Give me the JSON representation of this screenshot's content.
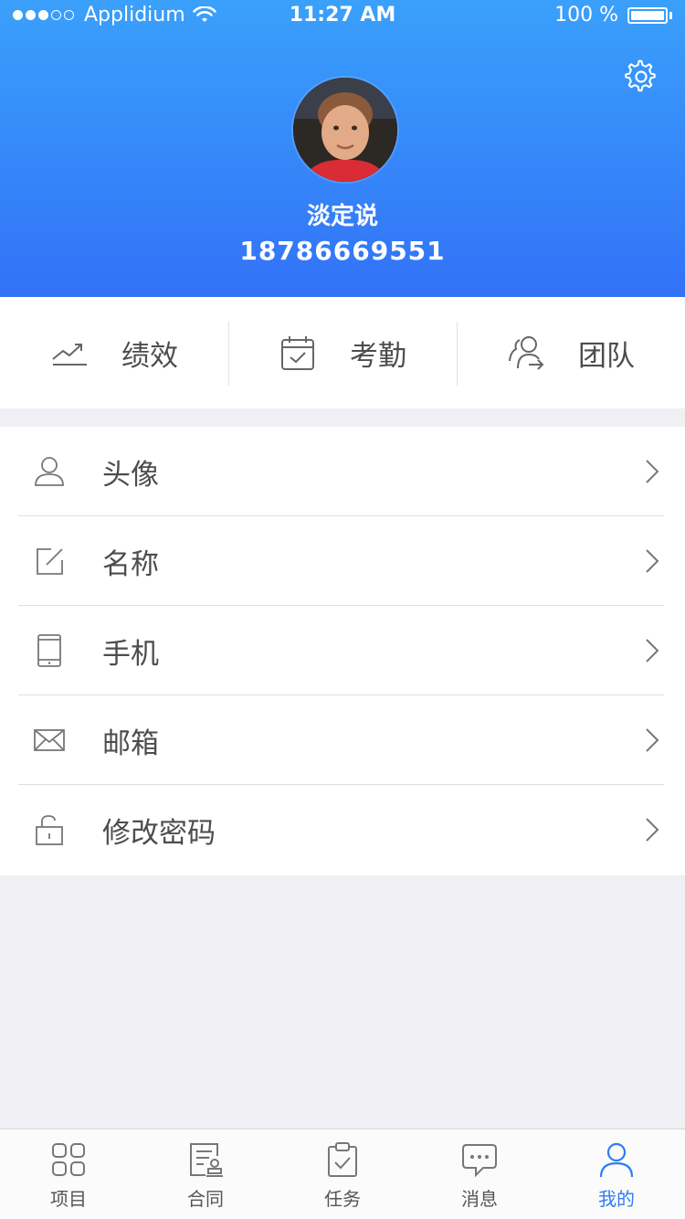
{
  "status_bar": {
    "carrier": "Applidium",
    "time": "11:27 AM",
    "battery": "100 %"
  },
  "profile": {
    "name": "淡定说",
    "phone": "18786669551"
  },
  "quick_actions": [
    {
      "label": "绩效",
      "icon": "trend-chart-icon"
    },
    {
      "label": "考勤",
      "icon": "calendar-check-icon"
    },
    {
      "label": "团队",
      "icon": "team-icon"
    }
  ],
  "menu": [
    {
      "label": "头像",
      "icon": "user-icon"
    },
    {
      "label": "名称",
      "icon": "edit-icon"
    },
    {
      "label": "手机",
      "icon": "phone-icon"
    },
    {
      "label": "邮箱",
      "icon": "mail-icon"
    },
    {
      "label": "修改密码",
      "icon": "lock-icon"
    }
  ],
  "tabs": [
    {
      "label": "项目",
      "icon": "grid-icon",
      "active": false
    },
    {
      "label": "合同",
      "icon": "contract-icon",
      "active": false
    },
    {
      "label": "任务",
      "icon": "clipboard-icon",
      "active": false
    },
    {
      "label": "消息",
      "icon": "chat-icon",
      "active": false
    },
    {
      "label": "我的",
      "icon": "person-icon",
      "active": true
    }
  ],
  "colors": {
    "header_top": "#3aa0fb",
    "header_bottom": "#3272f7",
    "active_tab": "#2f7cf6",
    "background": "#efeff4"
  }
}
